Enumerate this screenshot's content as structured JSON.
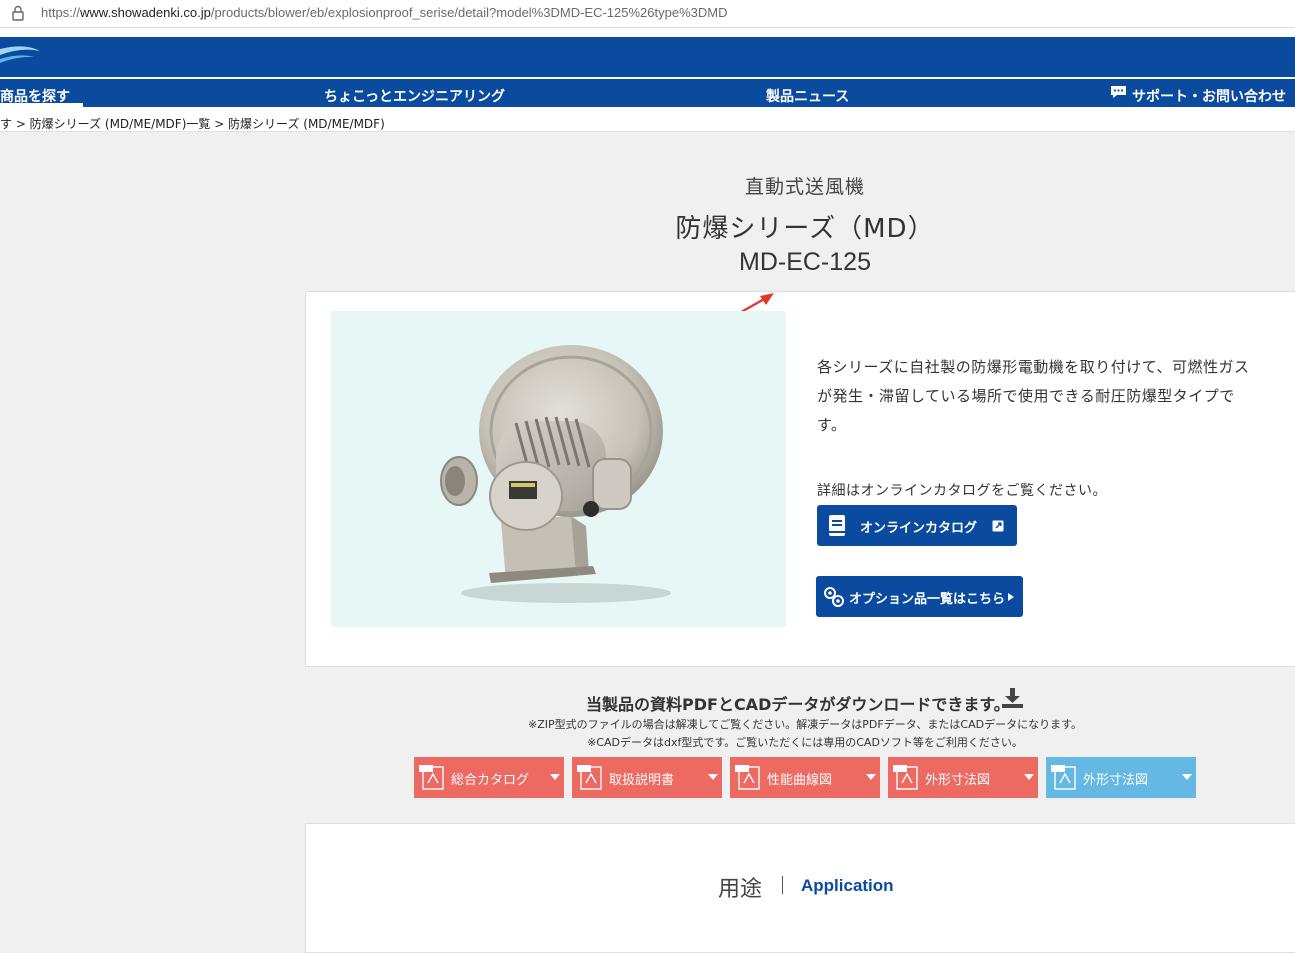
{
  "url": {
    "prefix": "https://",
    "domain": "www.showadenki.co.jp",
    "path": "/products/blower/eb/explosionproof_serise/detail?model%3DMD-EC-125%26type%3DMD"
  },
  "nav": {
    "items": [
      "商品を探す",
      "ちょこっとエンジニアリング",
      "製品ニュース",
      "サポート・お問い合わせ"
    ]
  },
  "breadcrumb": "す > 防爆シリーズ (MD/ME/MDF)一覧 > 防爆シリーズ (MD/ME/MDF)",
  "product": {
    "category": "直動式送風機",
    "series": "防爆シリーズ（MD）",
    "model": "MD-EC-125",
    "description": "各シリーズに自社製の防爆形電動機を取り付けて、可燃性ガスが発生・滞留している場所で使用できる耐圧防爆型タイプです。",
    "detail_note": "詳細はオンラインカタログをご覧ください。",
    "catalog_button": "オンラインカタログ",
    "option_button": "オプション品一覧はこちら"
  },
  "download": {
    "title": "当製品の資料PDFとCADデータがダウンロードできます。",
    "note1": "※ZIP型式のファイルの場合は解凍してご覧ください。解凍データはPDFデータ、またはCADデータになります。",
    "note2": "※CADデータはdxf型式です。ご覧いただくには専用のCADソフト等をご利用ください。",
    "buttons": [
      "総合カタログ",
      "取扱説明書",
      "性能曲線図",
      "外形寸法図",
      "外形寸法図"
    ]
  },
  "application": {
    "title_ja": "用途",
    "title_en": "Application"
  },
  "colors": {
    "brand_blue": "#0a4a9f",
    "pdf_red": "#ec6a62",
    "cad_blue": "#66b8e4",
    "photo_bg": "#e6f7f6",
    "annotation_arrow": "#e8352c"
  }
}
